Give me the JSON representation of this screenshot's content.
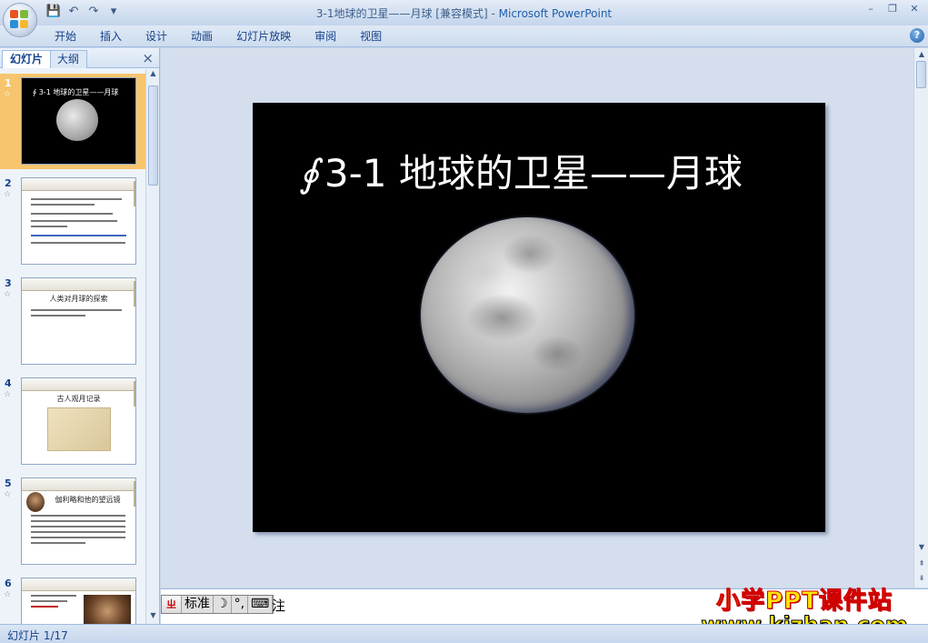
{
  "window": {
    "title_doc": "3-1地球的卫星——月球 [兼容模式]",
    "title_sep": " - ",
    "title_app": "Microsoft PowerPoint"
  },
  "qat": {
    "save": "💾",
    "undo": "↶",
    "redo": "↷",
    "more": "▾"
  },
  "window_controls": {
    "minimize": "–",
    "restore": "❐",
    "close": "✕"
  },
  "ribbon": {
    "tabs": [
      "开始",
      "插入",
      "设计",
      "动画",
      "幻灯片放映",
      "审阅",
      "视图"
    ],
    "help": "?"
  },
  "left_pane": {
    "tab_slides": "幻灯片",
    "tab_outline": "大纲",
    "close": "×",
    "slides": [
      {
        "num": "1",
        "title": "3-1 地球的卫星——月球"
      },
      {
        "num": "2"
      },
      {
        "num": "3",
        "title": "人类对月球的探索"
      },
      {
        "num": "4",
        "title": "古人观月记录"
      },
      {
        "num": "5",
        "title": "伽利略和他的望远镜"
      },
      {
        "num": "6"
      }
    ],
    "scroll_up": "▲",
    "scroll_down": "▼"
  },
  "slide": {
    "symbol": "∮",
    "title": "3-1 地球的卫星——月球"
  },
  "right_scroll": {
    "up": "▲",
    "down": "▼",
    "prev": "⇞",
    "next": "⇟"
  },
  "notes": {
    "ime_mode": "标准",
    "ime_logo": "ㄓ",
    "ime_moon": "☽",
    "ime_punct": "°,",
    "ime_kbd": "⌨",
    "text": "注"
  },
  "watermark": {
    "line1": "小学PPT课件站",
    "line2": "www.kjzhan.com"
  },
  "status": {
    "slide_info": "幻灯片 1/17"
  }
}
